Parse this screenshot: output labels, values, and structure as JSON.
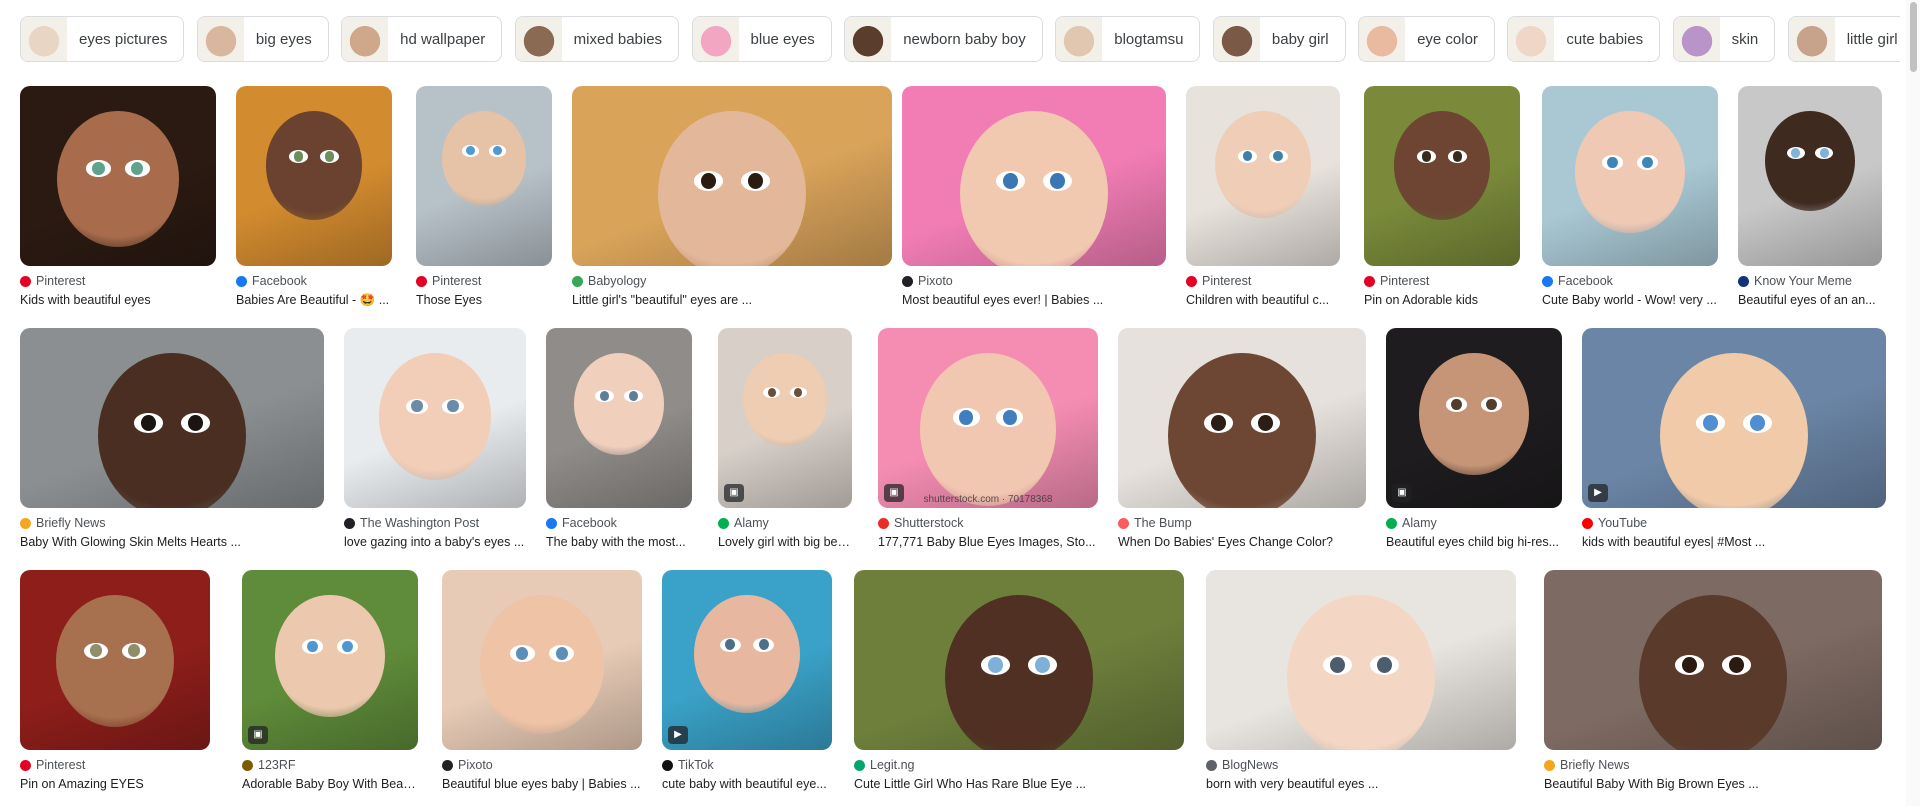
{
  "chips": [
    {
      "label": "eyes pictures",
      "tone": "#e8d5c4"
    },
    {
      "label": "big eyes",
      "tone": "#d8b79e"
    },
    {
      "label": "hd wallpaper",
      "tone": "#cfa88c"
    },
    {
      "label": "mixed babies",
      "tone": "#8a6a52"
    },
    {
      "label": "blue eyes",
      "tone": "#f2a6c2"
    },
    {
      "label": "newborn baby boy",
      "tone": "#5a3d2d"
    },
    {
      "label": "blogtamsu",
      "tone": "#e1c7b0"
    },
    {
      "label": "baby girl",
      "tone": "#7a5a46"
    },
    {
      "label": "eye color",
      "tone": "#e9b9a0"
    },
    {
      "label": "cute babies",
      "tone": "#efd6c6"
    },
    {
      "label": "skin",
      "tone": "#b994c8"
    },
    {
      "label": "little girl",
      "tone": "#c6a38a"
    }
  ],
  "rows": [
    [
      {
        "source": "Pinterest",
        "title": "Kids with beautiful eyes",
        "fav": "#e60023",
        "bg": "#2b1a12",
        "skin": "#a86c4c",
        "iris": "#5fa38c"
      },
      {
        "source": "Facebook",
        "title": "Babies Are Beautiful - 🤩 ...",
        "fav": "#1877f2",
        "bg": "#d38b2f",
        "skin": "#6b4230",
        "iris": "#6e8f5c"
      },
      {
        "source": "Pinterest",
        "title": "Those Eyes",
        "fav": "#e60023",
        "bg": "#b7c1c8",
        "skin": "#e6c2a7",
        "iris": "#4d9ad6"
      },
      {
        "source": "Babyology",
        "title": "Little girl's \"beautiful\" eyes are ...",
        "fav": "#34a853",
        "bg": "#d9a35a",
        "skin": "#e3b79a",
        "iris": "#2a1a10"
      },
      {
        "source": "Pixoto",
        "title": "Most beautiful eyes ever! | Babies ...",
        "fav": "#202124",
        "bg": "#f27db5",
        "skin": "#f1c8b0",
        "iris": "#3a78b5"
      },
      {
        "source": "Pinterest",
        "title": "Children with beautiful c...",
        "fav": "#e60023",
        "bg": "#e8e2dc",
        "skin": "#f0cdb7",
        "iris": "#3f7fa8"
      },
      {
        "source": "Pinterest",
        "title": "Pin on Adorable kids",
        "fav": "#e60023",
        "bg": "#7a8a3a",
        "skin": "#6d4532",
        "iris": "#3a2a1c"
      },
      {
        "source": "Facebook",
        "title": "Cute Baby world - Wow! very ...",
        "fav": "#1877f2",
        "bg": "#a9c8d4",
        "skin": "#f0c9b4",
        "iris": "#3e86b8"
      },
      {
        "source": "Know Your Meme",
        "title": "Beautiful eyes of an an...",
        "fav": "#13317b",
        "bg": "#c8c8c8",
        "skin": "#3f2a20",
        "iris": "#7fb3d8"
      }
    ],
    [
      {
        "source": "Briefly News",
        "title": "Baby With Glowing Skin Melts Hearts ...",
        "fav": "#f4a61c",
        "bg": "#8b8f91",
        "skin": "#4a2e22",
        "iris": "#1a1412"
      },
      {
        "source": "The Washington Post",
        "title": "love gazing into a baby's eyes ...",
        "fav": "#202124",
        "bg": "#e9ecef",
        "skin": "#f2cdb7",
        "iris": "#6a8ca8"
      },
      {
        "source": "Facebook",
        "title": "The baby with the most...",
        "fav": "#1877f2",
        "bg": "#8f8c89",
        "skin": "#f0cfbd",
        "iris": "#5d7f97"
      },
      {
        "source": "Alamy",
        "title": "Lovely girl with big bea...",
        "fav": "#00b050",
        "bg": "#d7cfc8",
        "skin": "#efcdb3",
        "iris": "#6b4f3a",
        "badge": "▣"
      },
      {
        "source": "Shutterstock",
        "title": "177,771 Baby Blue Eyes Images, Sto...",
        "fav": "#ee2b24",
        "bg": "#f58db2",
        "skin": "#f2c7b1",
        "iris": "#3f7fbf",
        "badge": "▣",
        "caption": "shutterstock.com · 70178368"
      },
      {
        "source": "The Bump",
        "title": "When Do Babies' Eyes Change Color?",
        "fav": "#ff5a5f",
        "bg": "#e6e1dc",
        "skin": "#6d4634",
        "iris": "#2a1e16"
      },
      {
        "source": "Alamy",
        "title": "Beautiful eyes child big hi-res...",
        "fav": "#00b050",
        "bg": "#1e1c1e",
        "skin": "#c69476",
        "iris": "#4f3d2e",
        "badge": "▣"
      },
      {
        "source": "YouTube",
        "title": "kids with beautiful eyes| #Most ...",
        "fav": "#ff0000",
        "bg": "#6b85a6",
        "skin": "#f0caa9",
        "iris": "#4f8fd1",
        "badge": "▶"
      }
    ],
    [
      {
        "source": "Pinterest",
        "title": "Pin on Amazing EYES",
        "fav": "#e60023",
        "bg": "#8e1e1a",
        "skin": "#a7714f",
        "iris": "#8e8f66"
      },
      {
        "source": "123RF",
        "title": "Adorable Baby Boy With Beau...",
        "fav": "#7c5b00",
        "bg": "#5f8c3a",
        "skin": "#ecc9ae",
        "iris": "#4f97cf",
        "badge": "▣"
      },
      {
        "source": "Pixoto",
        "title": "Beautiful blue eyes baby | Babies ...",
        "fav": "#202124",
        "bg": "#e7cbb6",
        "skin": "#efc3a6",
        "iris": "#5b8fb8"
      },
      {
        "source": "TikTok",
        "title": "cute baby with beautiful eye...",
        "fav": "#111111",
        "bg": "#3aa2c8",
        "skin": "#e8b7a0",
        "iris": "#4c6f8a",
        "badge": "▶"
      },
      {
        "source": "Legit.ng",
        "title": "Cute Little Girl Who Has Rare Blue Eye ...",
        "fav": "#00a86b",
        "bg": "#6e7f3c",
        "skin": "#4f3022",
        "iris": "#7fb0d8"
      },
      {
        "source": "BlogNews",
        "title": "born with very beautiful eyes ...",
        "fav": "#5f6368",
        "bg": "#e8e4df",
        "skin": "#f3d6c4",
        "iris": "#4c5d6b"
      },
      {
        "source": "Briefly News",
        "title": "Beautiful Baby With Big Brown Eyes ...",
        "fav": "#f4a61c",
        "bg": "#7d6a62",
        "skin": "#5a3a2a",
        "iris": "#2a1a12"
      }
    ]
  ]
}
